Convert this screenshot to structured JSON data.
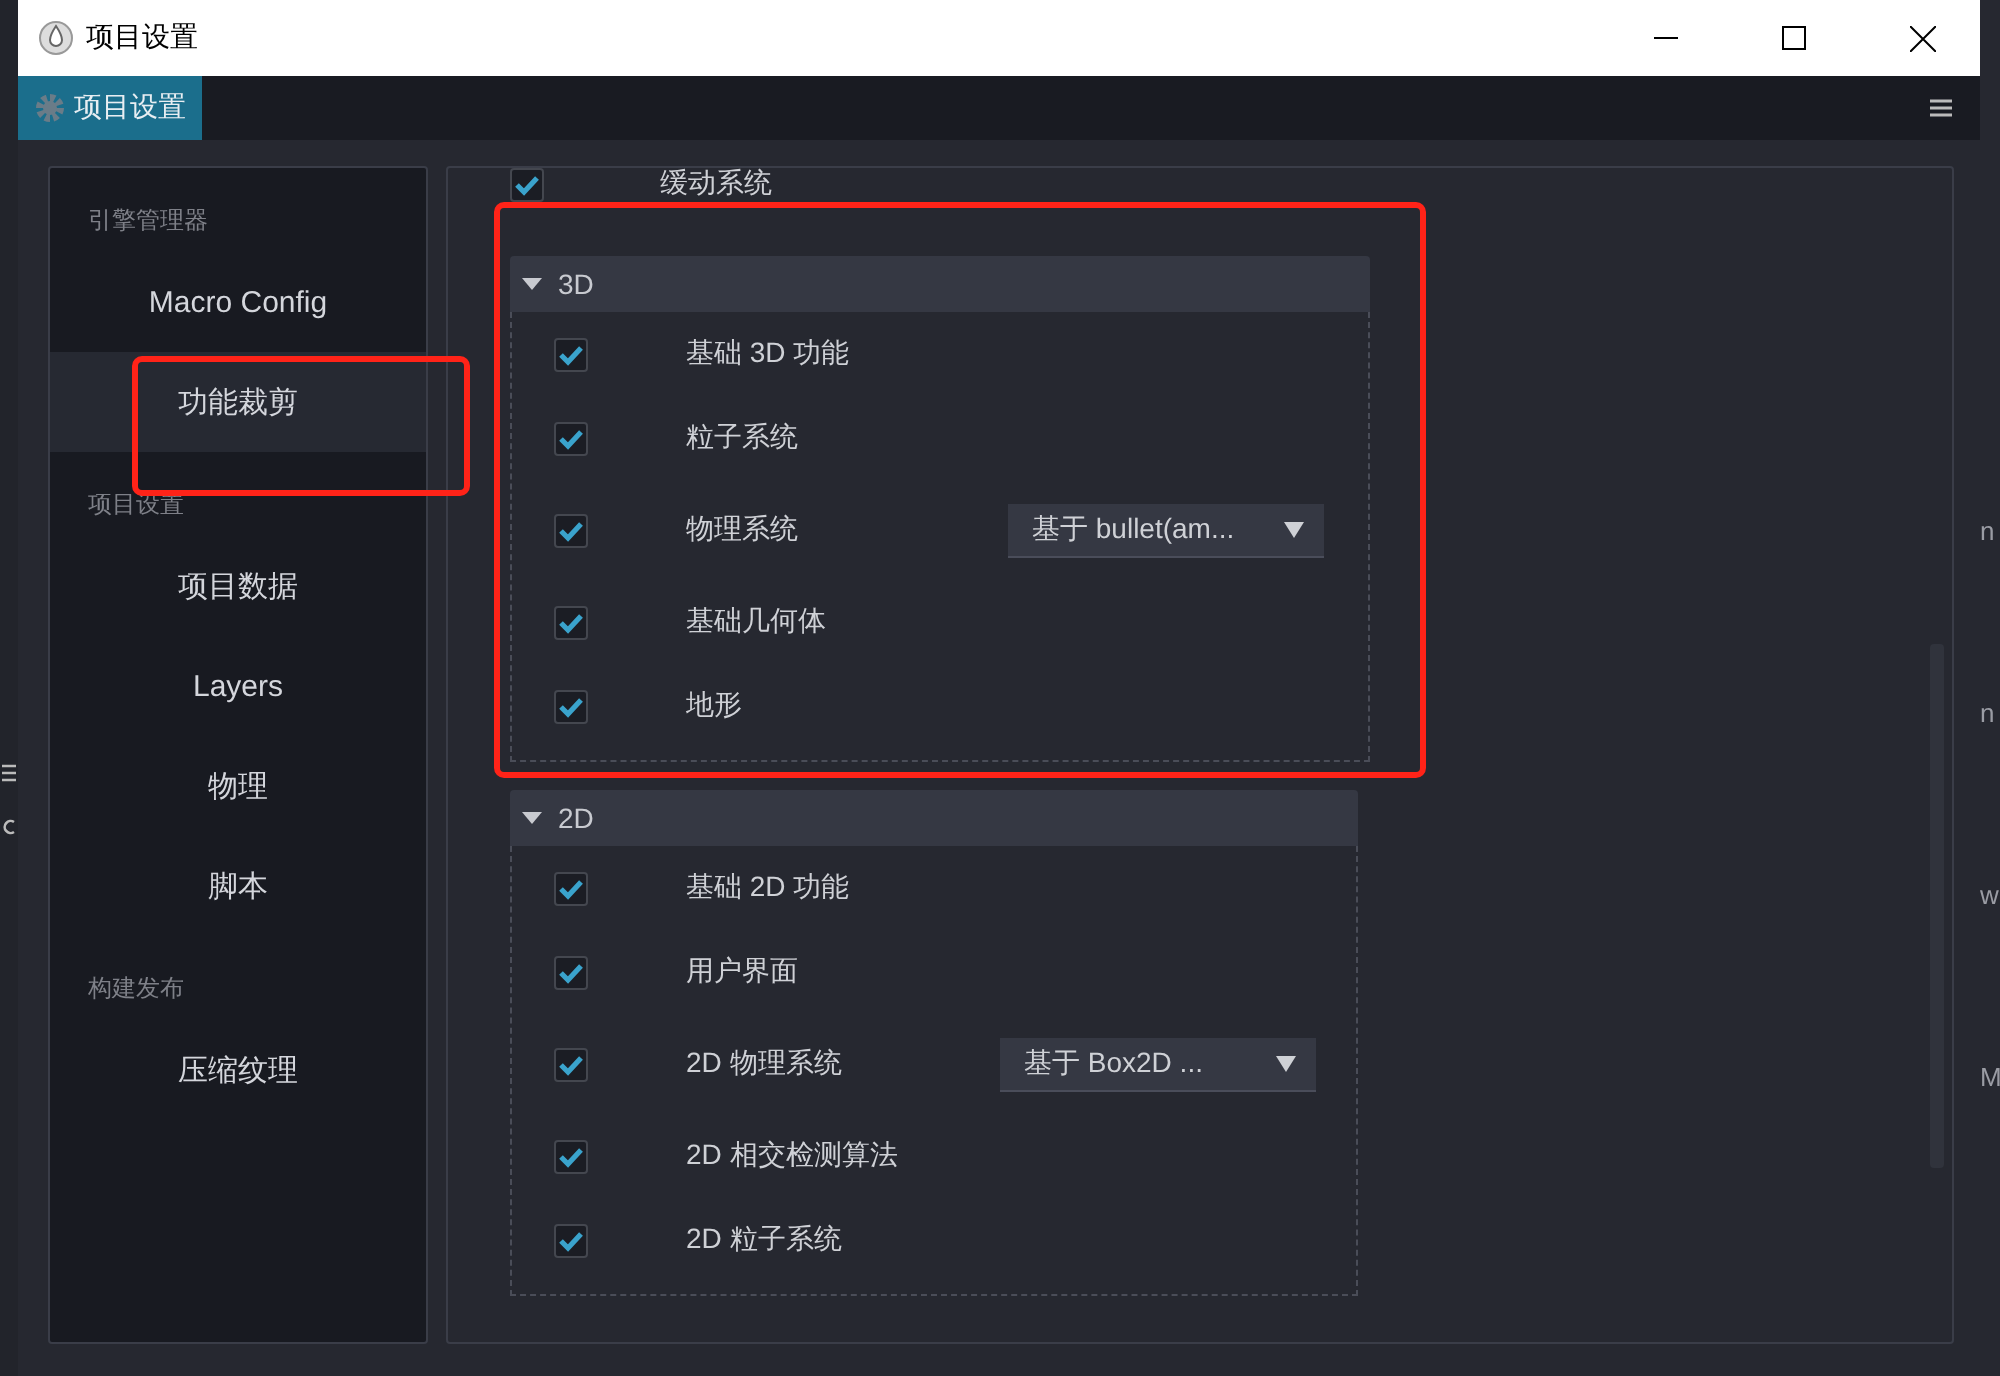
{
  "window": {
    "title": "项目设置"
  },
  "tabs": [
    {
      "label": "项目设置",
      "selected": true
    }
  ],
  "sidebar": {
    "groups": [
      {
        "heading": "引擎管理器",
        "items": [
          {
            "label": "Macro Config",
            "selected": false
          },
          {
            "label": "功能裁剪",
            "selected": true
          }
        ]
      },
      {
        "heading": "项目设置",
        "items": [
          {
            "label": "项目数据",
            "selected": false
          },
          {
            "label": "Layers",
            "selected": false
          },
          {
            "label": "物理",
            "selected": false
          },
          {
            "label": "脚本",
            "selected": false
          }
        ]
      },
      {
        "heading": "构建发布",
        "items": [
          {
            "label": "压缩纹理",
            "selected": false
          }
        ]
      }
    ]
  },
  "scrolled_row": {
    "label": "缓动系统",
    "checked": true
  },
  "sections": [
    {
      "title": "3D",
      "expanded": true,
      "rows": [
        {
          "label": "基础 3D 功能",
          "checked": true
        },
        {
          "label": "粒子系统",
          "checked": true
        },
        {
          "label": "物理系统",
          "checked": true,
          "dropdown": "基于 bullet(am..."
        },
        {
          "label": "基础几何体",
          "checked": true
        },
        {
          "label": "地形",
          "checked": true
        }
      ]
    },
    {
      "title": "2D",
      "expanded": true,
      "rows": [
        {
          "label": "基础 2D 功能",
          "checked": true
        },
        {
          "label": "用户界面",
          "checked": true
        },
        {
          "label": "2D 物理系统",
          "checked": true,
          "dropdown": "基于 Box2D ..."
        },
        {
          "label": "2D 相交检测算法",
          "checked": true
        },
        {
          "label": "2D 粒子系统",
          "checked": true
        }
      ]
    }
  ],
  "background_fragments": [
    "n",
    "n",
    "w",
    "M"
  ]
}
